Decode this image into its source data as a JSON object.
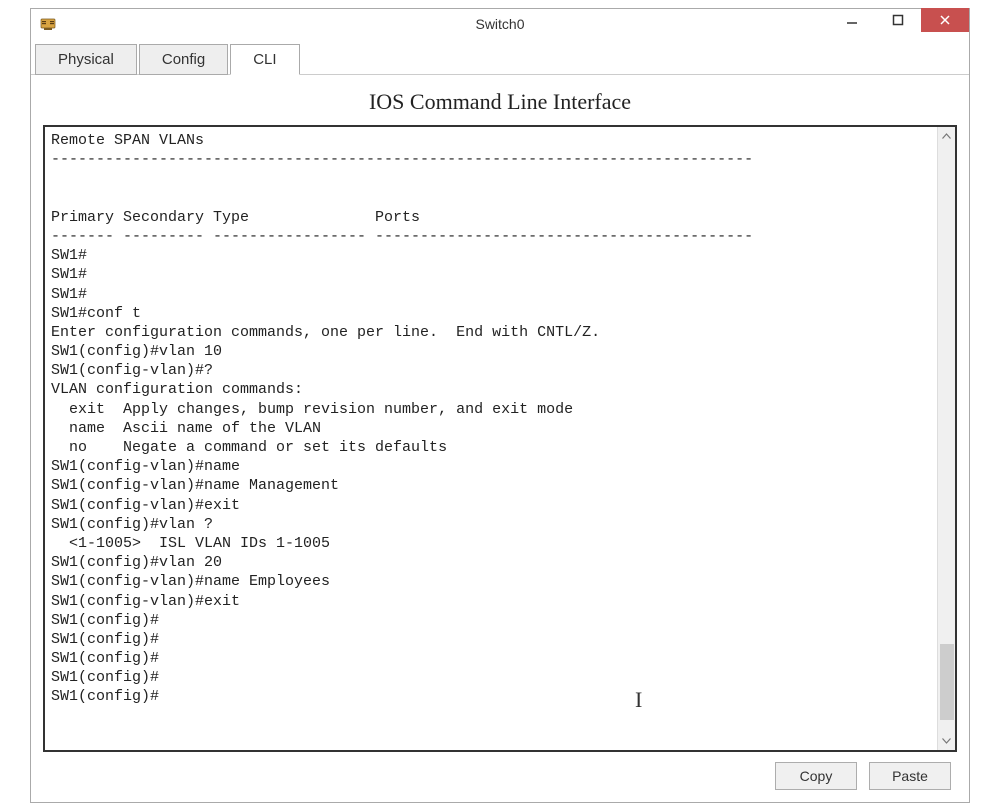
{
  "window": {
    "title": "Switch0"
  },
  "tabs": {
    "physical": "Physical",
    "config": "Config",
    "cli": "CLI"
  },
  "cli": {
    "heading": "IOS Command Line Interface",
    "output": "Remote SPAN VLANs\n------------------------------------------------------------------------------\n\n\nPrimary Secondary Type              Ports\n------- --------- ----------------- ------------------------------------------\nSW1#\nSW1#\nSW1#\nSW1#conf t\nEnter configuration commands, one per line.  End with CNTL/Z.\nSW1(config)#vlan 10\nSW1(config-vlan)#?\nVLAN configuration commands:\n  exit  Apply changes, bump revision number, and exit mode\n  name  Ascii name of the VLAN\n  no    Negate a command or set its defaults\nSW1(config-vlan)#name\nSW1(config-vlan)#name Management\nSW1(config-vlan)#exit\nSW1(config)#vlan ?\n  <1-1005>  ISL VLAN IDs 1-1005\nSW1(config)#vlan 20\nSW1(config-vlan)#name Employees\nSW1(config-vlan)#exit\nSW1(config)#\nSW1(config)#\nSW1(config)#\nSW1(config)#\nSW1(config)#"
  },
  "buttons": {
    "copy": "Copy",
    "paste": "Paste"
  }
}
